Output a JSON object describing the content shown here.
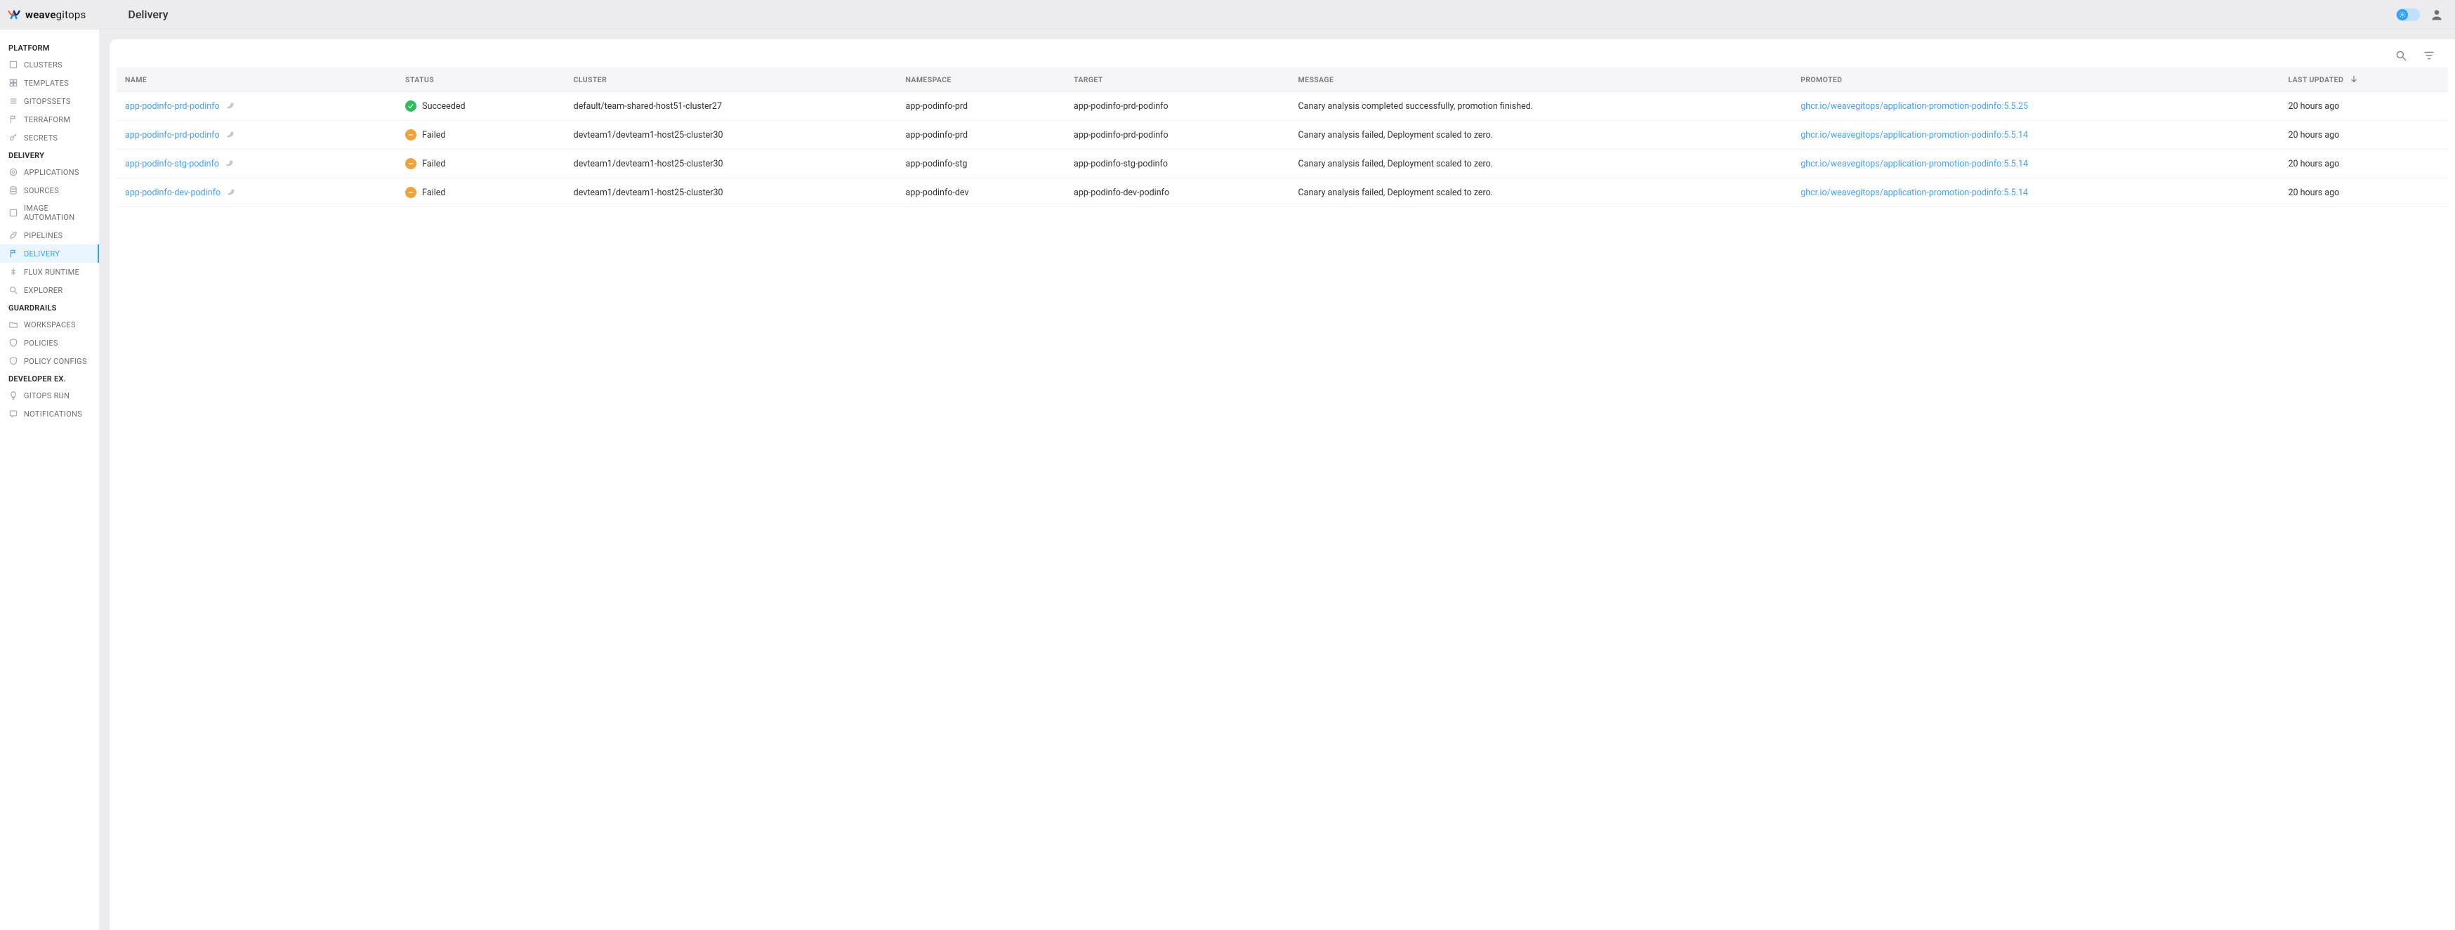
{
  "brand": {
    "bold": "weave",
    "thin": "gitops"
  },
  "page_title": "Delivery",
  "sidebar": {
    "sections": [
      {
        "label": "PLATFORM",
        "items": [
          {
            "id": "clusters",
            "label": "CLUSTERS",
            "icon": "clusters"
          },
          {
            "id": "templates",
            "label": "TEMPLATES",
            "icon": "templates"
          },
          {
            "id": "gitopssets",
            "label": "GITOPSSETS",
            "icon": "gitopssets"
          },
          {
            "id": "terraform",
            "label": "TERRAFORM",
            "icon": "terraform"
          },
          {
            "id": "secrets",
            "label": "SECRETS",
            "icon": "secrets"
          }
        ]
      },
      {
        "label": "DELIVERY",
        "items": [
          {
            "id": "applications",
            "label": "APPLICATIONS",
            "icon": "applications"
          },
          {
            "id": "sources",
            "label": "SOURCES",
            "icon": "sources"
          },
          {
            "id": "image-automation",
            "label": "IMAGE AUTOMATION",
            "icon": "image-automation"
          },
          {
            "id": "pipelines",
            "label": "PIPELINES",
            "icon": "pipelines"
          },
          {
            "id": "delivery",
            "label": "DELIVERY",
            "icon": "delivery",
            "active": true
          },
          {
            "id": "flux-runtime",
            "label": "FLUX RUNTIME",
            "icon": "flux"
          },
          {
            "id": "explorer",
            "label": "EXPLORER",
            "icon": "explorer"
          }
        ]
      },
      {
        "label": "GUARDRAILS",
        "items": [
          {
            "id": "workspaces",
            "label": "WORKSPACES",
            "icon": "workspaces"
          },
          {
            "id": "policies",
            "label": "POLICIES",
            "icon": "policies"
          },
          {
            "id": "policy-configs",
            "label": "POLICY CONFIGS",
            "icon": "policy-configs"
          }
        ]
      },
      {
        "label": "DEVELOPER EX.",
        "items": [
          {
            "id": "gitops-run",
            "label": "GITOPS RUN",
            "icon": "gitops-run"
          },
          {
            "id": "notifications",
            "label": "NOTIFICATIONS",
            "icon": "notifications"
          }
        ]
      }
    ]
  },
  "table": {
    "columns": [
      "NAME",
      "STATUS",
      "CLUSTER",
      "NAMESPACE",
      "TARGET",
      "MESSAGE",
      "PROMOTED",
      "LAST UPDATED"
    ],
    "rows": [
      {
        "name": "app-podinfo-prd-podinfo",
        "status": "Succeeded",
        "status_kind": "success",
        "cluster": "default/team-shared-host51-cluster27",
        "namespace": "app-podinfo-prd",
        "target": "app-podinfo-prd-podinfo",
        "message": "Canary analysis completed successfully, promotion finished.",
        "promoted": "ghcr.io/weavegitops/application-promotion-podinfo:5.5.25",
        "updated": "20 hours ago"
      },
      {
        "name": "app-podinfo-prd-podinfo",
        "status": "Failed",
        "status_kind": "failed",
        "cluster": "devteam1/devteam1-host25-cluster30",
        "namespace": "app-podinfo-prd",
        "target": "app-podinfo-prd-podinfo",
        "message": "Canary analysis failed, Deployment scaled to zero.",
        "promoted": "ghcr.io/weavegitops/application-promotion-podinfo:5.5.14",
        "updated": "20 hours ago"
      },
      {
        "name": "app-podinfo-stg-podinfo",
        "status": "Failed",
        "status_kind": "failed",
        "cluster": "devteam1/devteam1-host25-cluster30",
        "namespace": "app-podinfo-stg",
        "target": "app-podinfo-stg-podinfo",
        "message": "Canary analysis failed, Deployment scaled to zero.",
        "promoted": "ghcr.io/weavegitops/application-promotion-podinfo:5.5.14",
        "updated": "20 hours ago"
      },
      {
        "name": "app-podinfo-dev-podinfo",
        "status": "Failed",
        "status_kind": "failed",
        "cluster": "devteam1/devteam1-host25-cluster30",
        "namespace": "app-podinfo-dev",
        "target": "app-podinfo-dev-podinfo",
        "message": "Canary analysis failed, Deployment scaled to zero.",
        "promoted": "ghcr.io/weavegitops/application-promotion-podinfo:5.5.14",
        "updated": "20 hours ago"
      }
    ]
  }
}
